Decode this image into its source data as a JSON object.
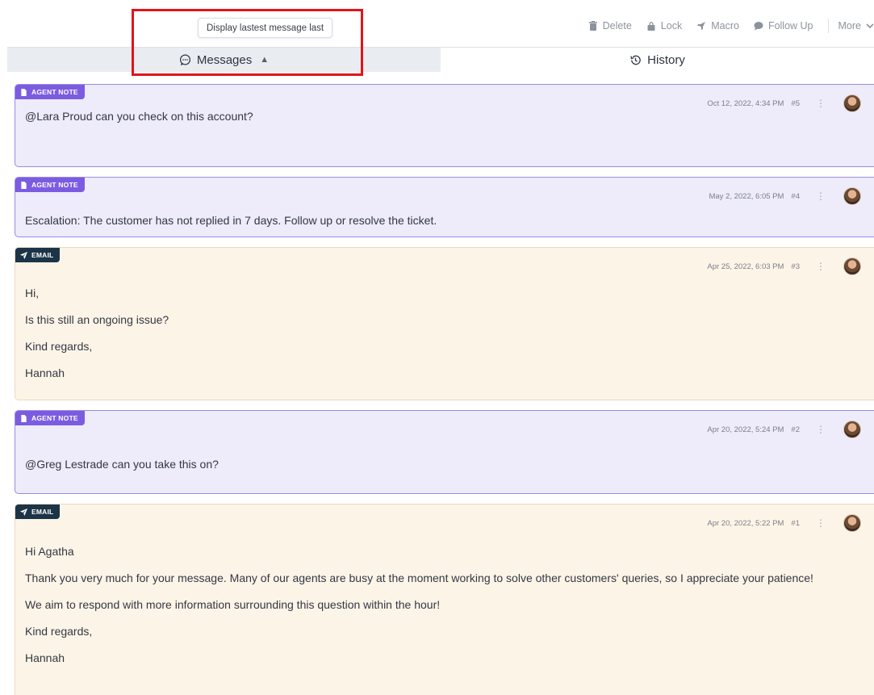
{
  "toolbar": {
    "actions": [
      {
        "label": "Delete",
        "icon": "trash-icon"
      },
      {
        "label": "Lock",
        "icon": "lock-icon"
      },
      {
        "label": "Macro",
        "icon": "rocket-icon"
      },
      {
        "label": "Follow Up",
        "icon": "chat-bubble-icon"
      },
      {
        "label": "More",
        "icon": "chevron-down-icon"
      }
    ]
  },
  "tooltip": "Display lastest message last",
  "tabs": [
    {
      "label": "Messages",
      "icon": "chat-bubble-icon",
      "sort_icon": "sort-icon"
    },
    {
      "label": "History",
      "icon": "history-icon"
    }
  ],
  "messages": [
    {
      "type": "AGENT NOTE",
      "date": "Oct 12, 2022, 4:34 PM",
      "num": "#5",
      "lines": [
        "@Lara Proud can you check on this account?"
      ]
    },
    {
      "type": "AGENT NOTE",
      "date": "May 2, 2022, 6:05 PM",
      "num": "#4",
      "lines": [
        "Escalation: The customer has not replied in 7 days. Follow up or resolve the ticket."
      ]
    },
    {
      "type": "EMAIL",
      "date": "Apr 25, 2022, 6:03 PM",
      "num": "#3",
      "lines": [
        "Hi,",
        "Is this still an ongoing issue?",
        "Kind regards,",
        "Hannah"
      ]
    },
    {
      "type": "AGENT NOTE",
      "date": "Apr 20, 2022, 5:24 PM",
      "num": "#2",
      "lines": [
        "@Greg Lestrade can you take this on?"
      ]
    },
    {
      "type": "EMAIL",
      "date": "Apr 20, 2022, 5:22 PM",
      "num": "#1",
      "lines": [
        "Hi Agatha",
        "Thank you very much for your message. Many of our agents are busy at the moment working to solve other customers' queries, so I appreciate your patience!",
        "We aim to respond with more information surrounding this question within the hour!",
        "Kind regards,",
        "Hannah"
      ]
    }
  ],
  "colors": {
    "note_bg": "#eeebfa",
    "note_badge": "#7b5ce0",
    "email_bg": "#fdf4e8",
    "email_badge": "#1c3447",
    "highlight": "#e0151b"
  }
}
